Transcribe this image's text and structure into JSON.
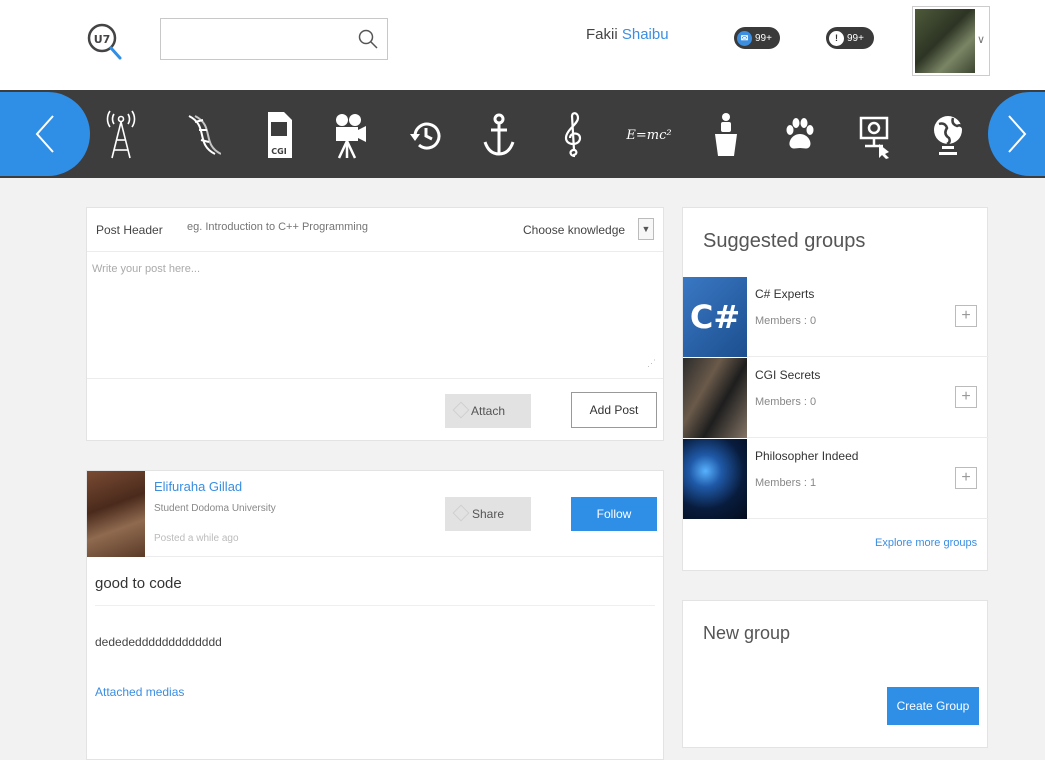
{
  "header": {
    "search_placeholder": "",
    "user_first": "Fakii",
    "user_last": "Shaibu",
    "messages_badge": "99+",
    "notifications_badge": "99+"
  },
  "categories": [
    {
      "name": "antenna-icon"
    },
    {
      "name": "dna-icon"
    },
    {
      "name": "cgi-file-icon",
      "label": "CGI"
    },
    {
      "name": "movie-camera-icon"
    },
    {
      "name": "history-icon"
    },
    {
      "name": "anchor-icon"
    },
    {
      "name": "treble-clef-icon"
    },
    {
      "name": "physics-formula-icon",
      "label": "E=mc²"
    },
    {
      "name": "speaker-podium-icon"
    },
    {
      "name": "paw-icon"
    },
    {
      "name": "computer-science-icon"
    },
    {
      "name": "globe-icon"
    }
  ],
  "composer": {
    "header_label": "Post Header",
    "header_placeholder": "eg. Introduction to C++ Programming",
    "knowledge_label": "Choose knowledge",
    "body_placeholder": "Write your post here...",
    "attach_label": "Attach",
    "add_post_label": "Add Post"
  },
  "post": {
    "author": "Elifuraha Gillad",
    "subtitle": "Student Dodoma University",
    "time": "Posted a while ago",
    "share_label": "Share",
    "follow_label": "Follow",
    "title": "good to code",
    "body": "dedededdddddddddddd",
    "media_link": "Attached medias"
  },
  "suggested_groups": {
    "title": "Suggested groups",
    "items": [
      {
        "name": "C# Experts",
        "members": "Members : 0",
        "image_label": "C#"
      },
      {
        "name": "CGI Secrets",
        "members": "Members : 0"
      },
      {
        "name": "Philosopher Indeed",
        "members": "Members : 1"
      }
    ],
    "explore_label": "Explore more groups"
  },
  "new_group": {
    "title": "New group",
    "create_label": "Create Group"
  },
  "colors": {
    "accent": "#2f8ee6",
    "band": "#3d3d3d",
    "link": "#3b8ee0"
  }
}
